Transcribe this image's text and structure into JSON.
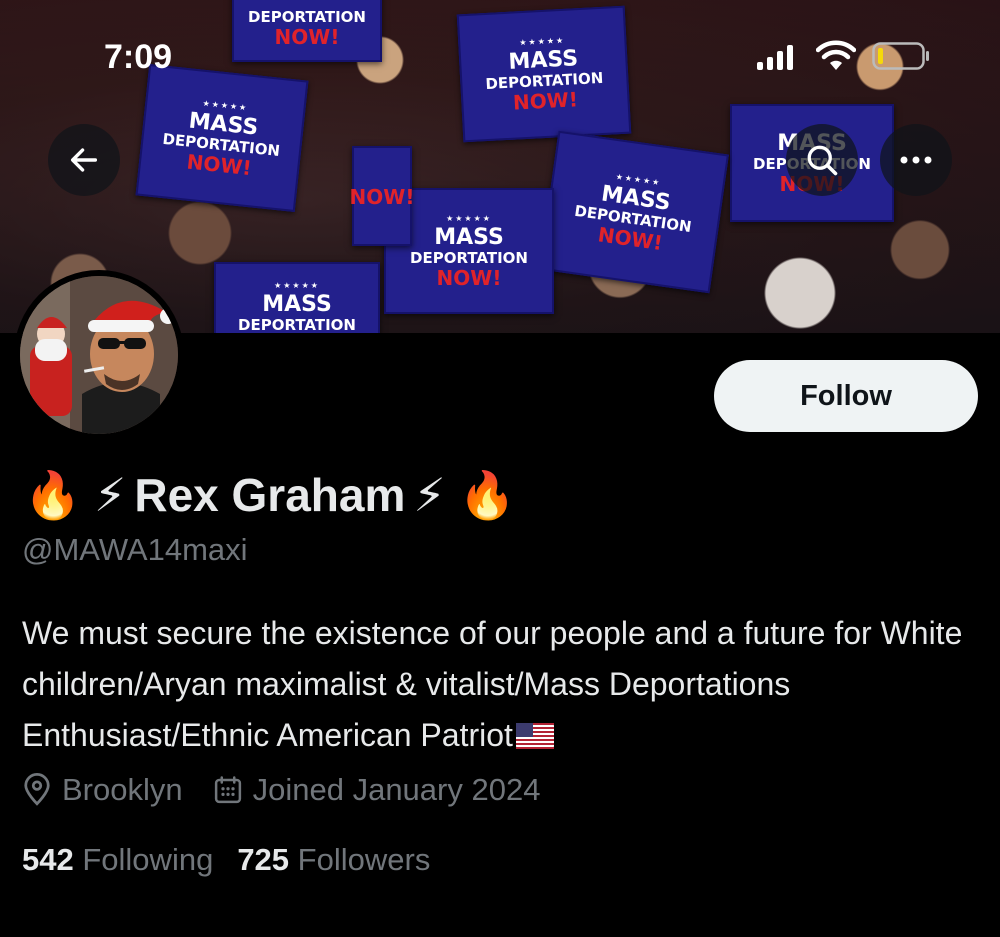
{
  "status_bar": {
    "time": "7:09"
  },
  "banner": {
    "signs": [
      {
        "line1": "MASS",
        "line2": "DEPORTATION",
        "line3": "NOW!"
      },
      {
        "line1": "MASS",
        "line2": "DEPORTATION",
        "line3": "NOW!"
      },
      {
        "line1": "MASS",
        "line2": "DEPORTATION",
        "line3": "NOW!"
      },
      {
        "line1": "MASS",
        "line2": "DEPORTATION",
        "line3": "NOW!"
      },
      {
        "line1": "MASS",
        "line2": "DEPORTATION",
        "line3": "NOW!"
      },
      {
        "line1": "MASS",
        "line2": "DEPORTATION",
        "line3": "NOW!"
      },
      {
        "line1": "MASS",
        "line2": "DEPORTATION",
        "line3": ""
      },
      {
        "line1": "",
        "line2": "DEPORTATION",
        "line3": "NOW!"
      }
    ]
  },
  "profile": {
    "display_name": "Rex Graham",
    "name_emoji_left": "🔥 ⚡",
    "name_emoji_right": "⚡ 🔥",
    "handle": "@MAWA14maxi",
    "follow_label": "Follow",
    "bio": "We must secure the existence of our people and a future for White children/Aryan maximalist & vitalist/Mass Deportations Enthusiast/Ethnic American Patriot",
    "location": "Brooklyn",
    "joined": "Joined January 2024",
    "following_count": "542",
    "following_label": "Following",
    "followers_count": "725",
    "followers_label": "Followers"
  },
  "icons": {
    "back": "arrow-left-icon",
    "search": "search-icon",
    "more": "more-horizontal-icon",
    "location": "location-pin-icon",
    "calendar": "calendar-icon",
    "flag": "us-flag-icon"
  },
  "colors": {
    "background": "#000000",
    "text_primary": "#e7e9ea",
    "text_secondary": "#71767b",
    "follow_button_bg": "#eff3f4",
    "sign_blue": "#23208c",
    "sign_red": "#e0232a"
  }
}
